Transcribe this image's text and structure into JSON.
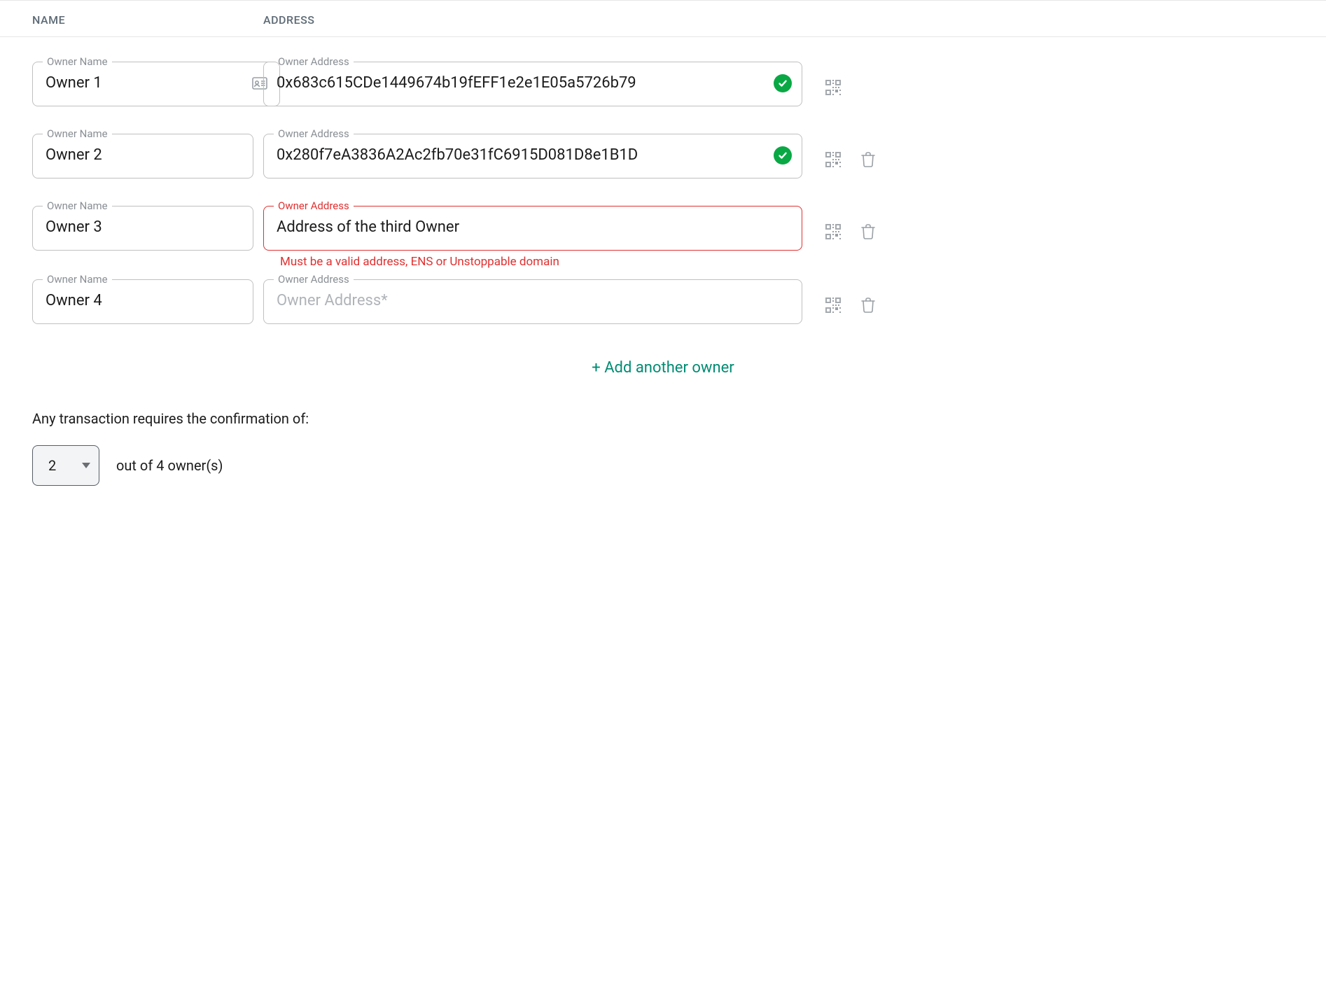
{
  "columns": {
    "name": "NAME",
    "address": "ADDRESS"
  },
  "labels": {
    "owner_name": "Owner Name",
    "owner_address": "Owner Address"
  },
  "owners": [
    {
      "name": "Owner 1",
      "address": "0x683c615CDe1449674b19fEFF1e2e1E05a5726b79",
      "valid": true,
      "deletable": false,
      "has_id_icon": true
    },
    {
      "name": "Owner 2",
      "address": "0x280f7eA3836A2Ac2fb70e31fC6915D081D8e1B1D",
      "valid": true,
      "deletable": true,
      "has_id_icon": false
    },
    {
      "name": "Owner 3",
      "address": "Address of the third Owner",
      "valid": false,
      "error": "Must be a valid address, ENS or Unstoppable domain",
      "deletable": true,
      "has_id_icon": false
    },
    {
      "name": "Owner 4",
      "address": "",
      "placeholder": "Owner Address*",
      "valid": null,
      "deletable": true,
      "has_id_icon": false
    }
  ],
  "add_owner_label": "+ Add another owner",
  "confirmation": {
    "label": "Any transaction requires the confirmation of:",
    "selected": "2",
    "suffix": "out of 4 owner(s)"
  }
}
